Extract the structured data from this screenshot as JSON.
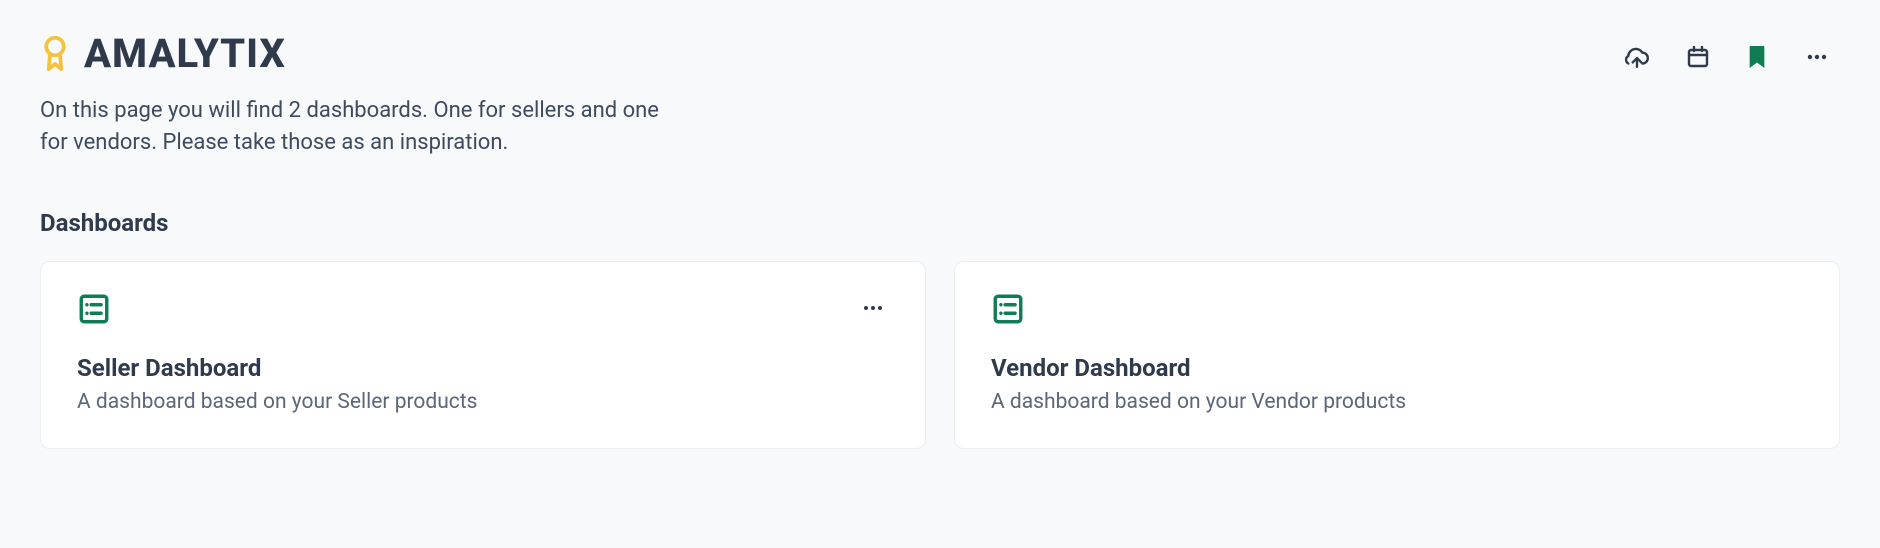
{
  "brand": {
    "name": "AMALYTIX"
  },
  "page": {
    "subtitle": "On this page you will find 2 dashboards. One for sellers and one for vendors. Please take those as an inspiration.",
    "section_title": "Dashboards"
  },
  "dashboards": [
    {
      "title": "Seller Dashboard",
      "description": "A dashboard based on your Seller products",
      "show_more": true
    },
    {
      "title": "Vendor Dashboard",
      "description": "A dashboard based on your Vendor products",
      "show_more": false
    }
  ],
  "colors": {
    "accent_green": "#107c54",
    "accent_yellow": "#f5c23e",
    "text_dark": "#2f3a4c"
  }
}
